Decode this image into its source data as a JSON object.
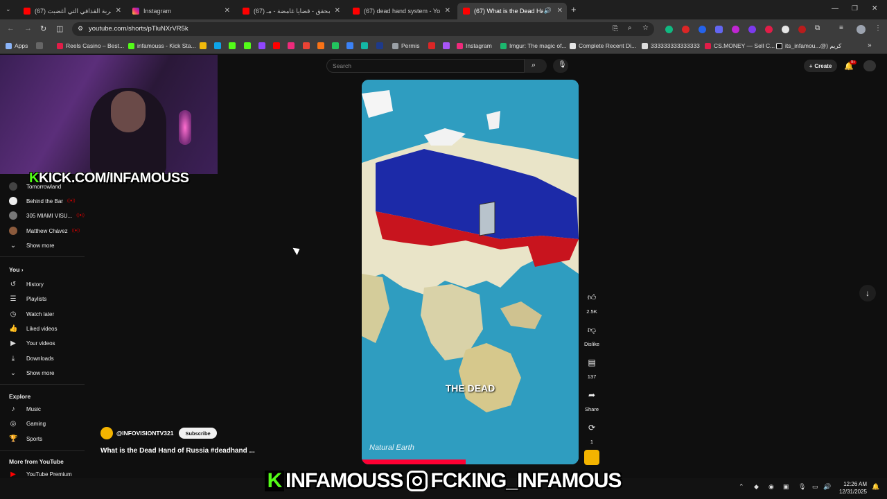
{
  "browser": {
    "tabs": [
      {
        "title": "(67) ضربة القذافي التي أغضبت",
        "active": false
      },
      {
        "title": "Instagram",
        "active": false
      },
      {
        "title": "(67) المحقق - قضايا غامضة - مـ",
        "active": false
      },
      {
        "title": "(67) dead hand system - YouTu",
        "active": false
      },
      {
        "title": "(67) What is the Dead Hand",
        "active": true
      }
    ],
    "url": "youtube.com/shorts/pTluNXrVR5k",
    "bookmarks": [
      {
        "label": "Apps"
      },
      {
        "label": "Reels Casino – Best..."
      },
      {
        "label": "infamouss - Kick Sta..."
      },
      {
        "label": "Permis"
      },
      {
        "label": "Instagram"
      },
      {
        "label": "Imgur: The magic of..."
      },
      {
        "label": "Complete Recent Di..."
      },
      {
        "label": "333333333333333"
      },
      {
        "label": "CS.MONEY — Sell C..."
      },
      {
        "label": "its_infamou...@) كريم"
      }
    ]
  },
  "overlays": {
    "webcam_kick": "KICK.COM/INFAMOUSS",
    "bottom_kick": "INFAMOUSS",
    "bottom_ig": "FCKING_INFAMOUS"
  },
  "header": {
    "search_placeholder": "Search",
    "create_label": "Create",
    "notification_count": "9+"
  },
  "sidebar": {
    "subscriptions": [
      {
        "label": "Tomorrowland",
        "live": true
      },
      {
        "label": "Behind the Bar",
        "live": true
      },
      {
        "label": "305 MIAMI VISU...",
        "live": true
      },
      {
        "label": "Matthew Chávez",
        "live": true
      }
    ],
    "show_more_1": "Show more",
    "you_heading": "You",
    "you_items": [
      {
        "label": "History",
        "icon": "history-icon"
      },
      {
        "label": "Playlists",
        "icon": "playlists-icon"
      },
      {
        "label": "Watch later",
        "icon": "watch-later-icon"
      },
      {
        "label": "Liked videos",
        "icon": "like-icon"
      },
      {
        "label": "Your videos",
        "icon": "your-videos-icon"
      },
      {
        "label": "Downloads",
        "icon": "download-icon"
      }
    ],
    "show_more_2": "Show more",
    "explore_heading": "Explore",
    "explore_items": [
      {
        "label": "Music",
        "icon": "music-icon"
      },
      {
        "label": "Gaming",
        "icon": "gaming-icon"
      },
      {
        "label": "Sports",
        "icon": "trophy-icon"
      }
    ],
    "more_heading": "More from YouTube",
    "more_items": [
      {
        "label": "YouTube Premium",
        "icon": "youtube-premium-icon"
      }
    ]
  },
  "short": {
    "caption": "THE DEAD",
    "map_credit": "Natural Earth",
    "likes": "2.5K",
    "dislike_label": "Dislike",
    "comments": "137",
    "share_label": "Share",
    "remix_count": "1",
    "channel": "@INFOVISIONTV321",
    "subscribe_label": "Subscribe",
    "title": "What is the Dead Hand of Russia #deadhand ..."
  },
  "taskbar": {
    "time": "12:26 AM",
    "date": "12/31/2025"
  },
  "colors": {
    "kick_green": "#53fc18",
    "youtube_red": "#ff0000",
    "russia_blue": "#1c2aa8",
    "russia_red": "#c8141e"
  }
}
